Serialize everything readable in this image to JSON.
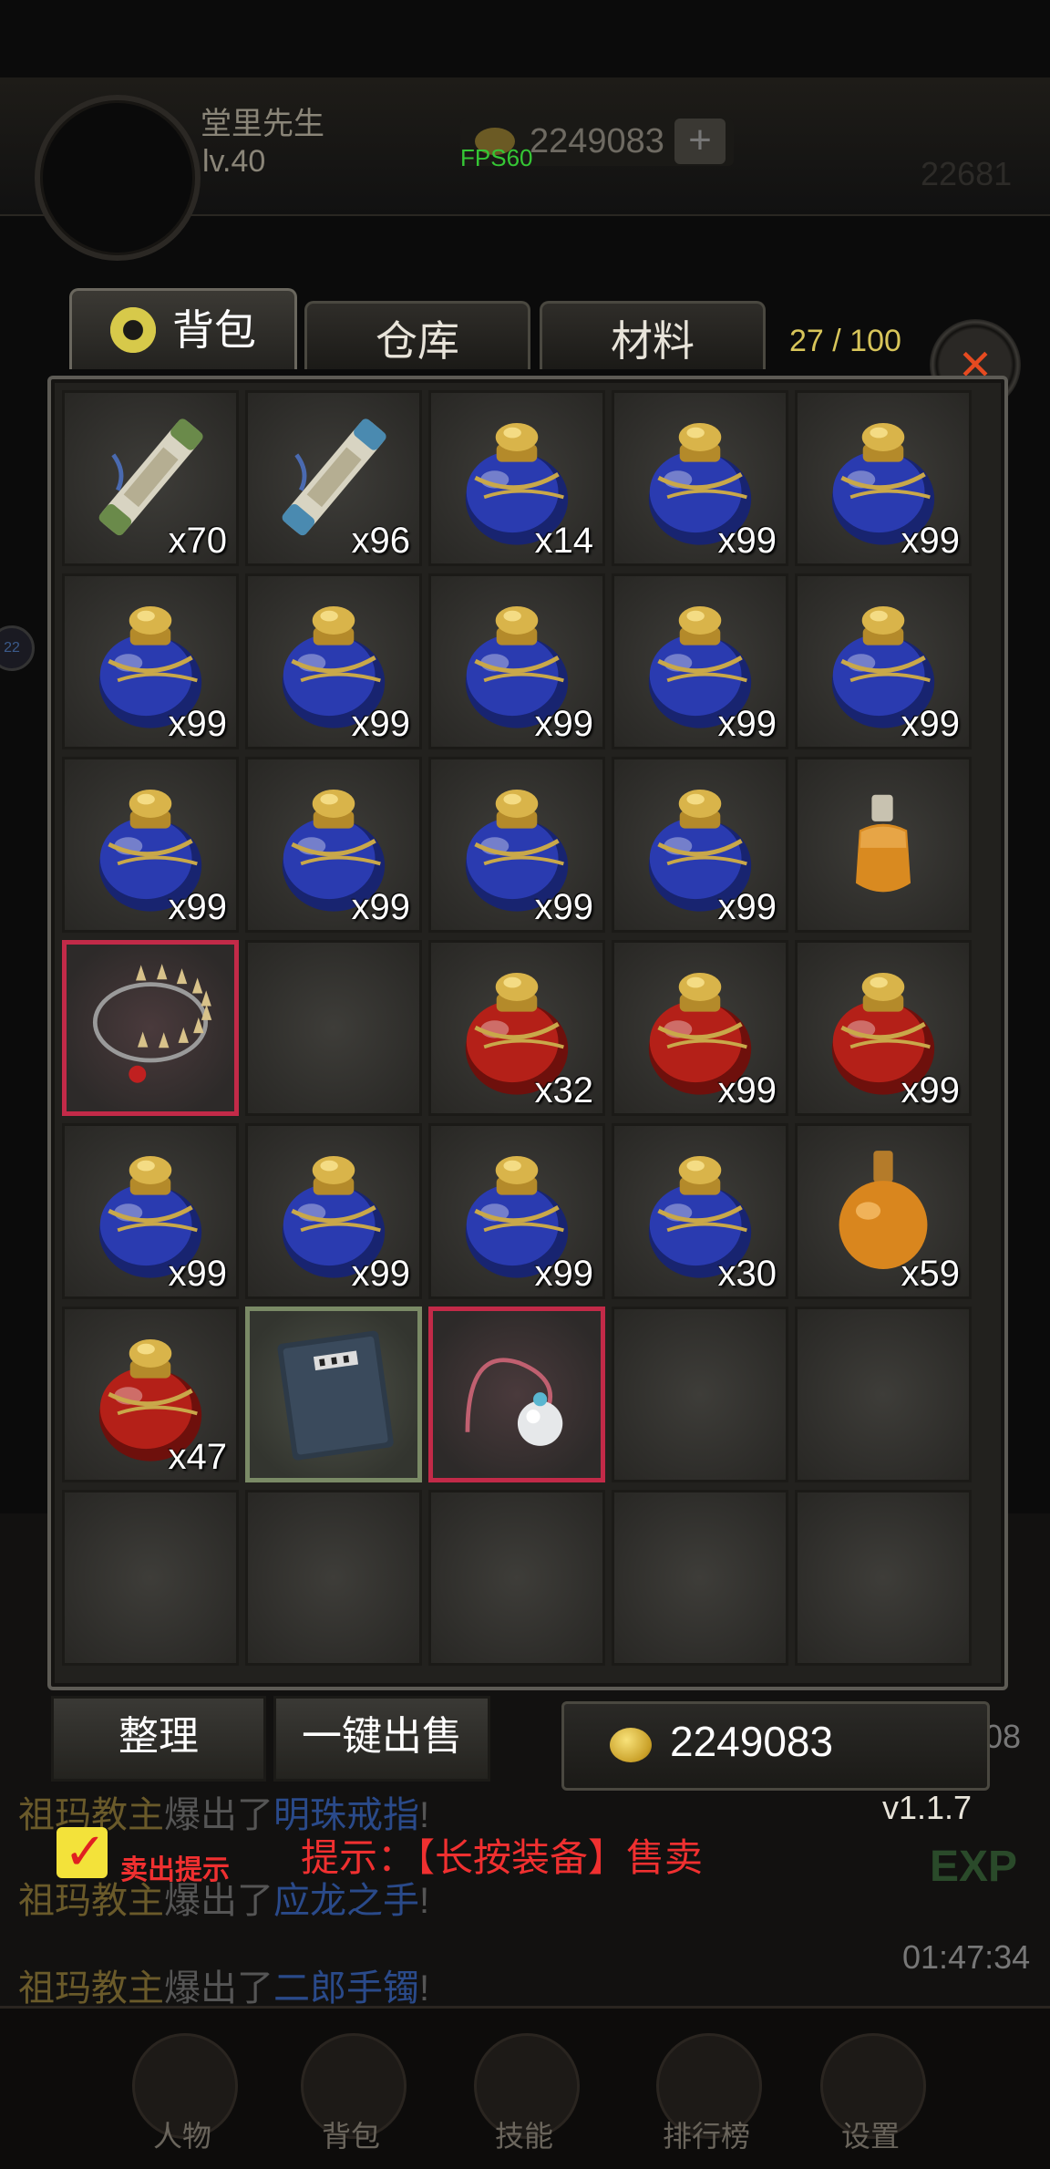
{
  "player": {
    "name": "堂里先生",
    "level": "lv.40",
    "gold": "2249083",
    "fps": "FPS60",
    "plus_label": "+",
    "right_num": "22681"
  },
  "tabs": [
    {
      "label": "背包",
      "active": true
    },
    {
      "label": "仓库",
      "active": false
    },
    {
      "label": "材料",
      "active": false
    }
  ],
  "capacity": "27 / 100",
  "close_label": "✕",
  "slots": [
    {
      "icon": "scroll-green-icon",
      "qty": "x70"
    },
    {
      "icon": "scroll-blue-icon",
      "qty": "x96"
    },
    {
      "icon": "blue-potion-icon",
      "qty": "x14"
    },
    {
      "icon": "blue-potion-icon",
      "qty": "x99"
    },
    {
      "icon": "blue-potion-icon",
      "qty": "x99"
    },
    {
      "icon": "blue-potion-icon",
      "qty": "x99"
    },
    {
      "icon": "blue-potion-icon",
      "qty": "x99"
    },
    {
      "icon": "blue-potion-icon",
      "qty": "x99"
    },
    {
      "icon": "blue-potion-icon",
      "qty": "x99"
    },
    {
      "icon": "blue-potion-icon",
      "qty": "x99"
    },
    {
      "icon": "blue-potion-icon",
      "qty": "x99"
    },
    {
      "icon": "blue-potion-icon",
      "qty": "x99"
    },
    {
      "icon": "blue-potion-icon",
      "qty": "x99"
    },
    {
      "icon": "blue-potion-icon",
      "qty": "x99"
    },
    {
      "icon": "orange-bottle-small-icon",
      "qty": ""
    },
    {
      "icon": "fang-necklace-icon",
      "qty": "",
      "border": "red"
    },
    {
      "icon": "",
      "qty": ""
    },
    {
      "icon": "red-potion-icon",
      "qty": "x32"
    },
    {
      "icon": "red-potion-icon",
      "qty": "x99"
    },
    {
      "icon": "red-potion-icon",
      "qty": "x99"
    },
    {
      "icon": "blue-potion-icon",
      "qty": "x99"
    },
    {
      "icon": "blue-potion-icon",
      "qty": "x99"
    },
    {
      "icon": "blue-potion-icon",
      "qty": "x99"
    },
    {
      "icon": "blue-potion-icon",
      "qty": "x30"
    },
    {
      "icon": "orange-flask-icon",
      "qty": "x59"
    },
    {
      "icon": "red-potion-icon",
      "qty": "x47"
    },
    {
      "icon": "book-icon",
      "qty": "",
      "border": "green"
    },
    {
      "icon": "pearl-amulet-icon",
      "qty": "",
      "border": "red"
    },
    {
      "icon": "",
      "qty": ""
    },
    {
      "icon": "",
      "qty": ""
    },
    {
      "icon": "",
      "qty": ""
    },
    {
      "icon": "",
      "qty": ""
    },
    {
      "icon": "",
      "qty": ""
    },
    {
      "icon": "",
      "qty": ""
    },
    {
      "icon": "",
      "qty": ""
    }
  ],
  "buttons": {
    "sort": "整理",
    "sell_all": "一键出售"
  },
  "gold_amount": "2249083",
  "version": "v1.1.7",
  "sell_tip_label": "卖出提示",
  "hint": "提示：【长按装备】售卖",
  "exp_label": "EXP",
  "times": [
    "08",
    "01:47:34"
  ],
  "chat": [
    {
      "who": "祖玛教主",
      "verb": "爆出了",
      "item": "明珠戒指",
      "end": "!"
    },
    {
      "who": "祖玛教主",
      "verb": "爆出了",
      "item": "应龙之手",
      "end": "!"
    },
    {
      "who": "祖玛教主",
      "verb": "爆出了",
      "item": "二郎手镯",
      "end": "!"
    }
  ],
  "nav": [
    "人物",
    "背包",
    "技能",
    "排行榜",
    "设置"
  ],
  "colors": {
    "accent_gold": "#d8c55a",
    "hint_red": "#f03030",
    "rare_border": "#c22a48"
  }
}
